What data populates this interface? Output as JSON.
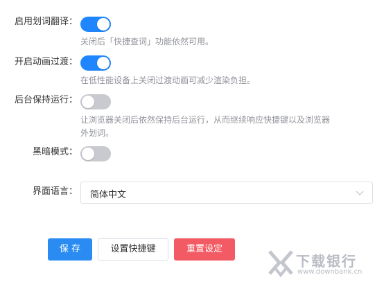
{
  "settings": {
    "word_translate": {
      "label": "启用划词翻译：",
      "enabled": true,
      "description": "关闭后「快捷查词」功能依然可用。"
    },
    "transition": {
      "label": "开启动画过渡：",
      "enabled": true,
      "description": "在低性能设备上关闭过渡动画可减少渲染负担。"
    },
    "background_run": {
      "label": "后台保持运行：",
      "enabled": false,
      "description_line1": "让浏览器关闭后依然保持后台运行，从而继续响应快捷键以及浏览器",
      "description_line2": "外划词。"
    },
    "dark_mode": {
      "label": "黑暗模式：",
      "enabled": false
    },
    "language": {
      "label": "界面语言：",
      "selected": "简体中文"
    }
  },
  "buttons": {
    "save": "保 存",
    "shortcut": "设置快捷键",
    "reset": "重置设定"
  },
  "watermark": {
    "name": "下载银行",
    "url": "www.downbank.cn"
  },
  "colors": {
    "switch_on": "#1f86ff",
    "switch_off": "#c8cacf",
    "primary": "#2a8cf3",
    "danger": "#f25b64"
  },
  "icons": {
    "select_arrow": "chevron-down-icon",
    "watermark_logo": "downbank-logo"
  }
}
